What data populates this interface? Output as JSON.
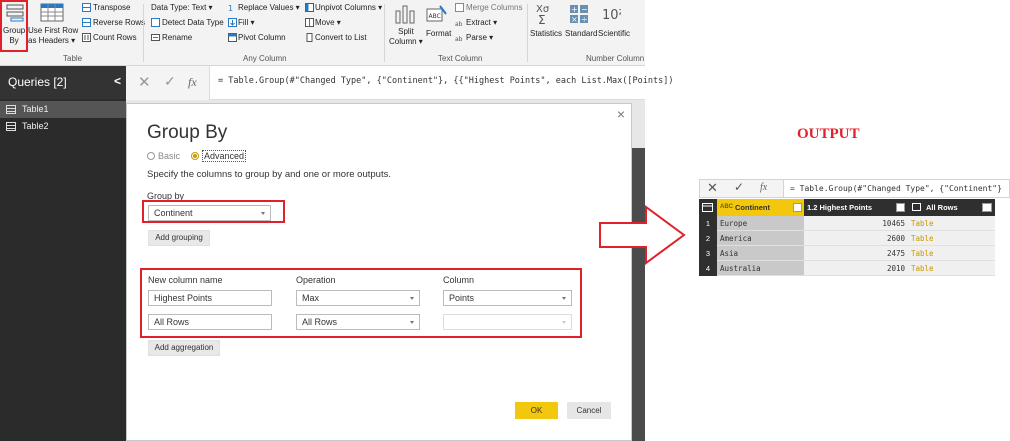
{
  "ribbon": {
    "group_by": "Group\nBy",
    "group_by_l1": "Group",
    "group_by_l2": "By",
    "use_first_row_l1": "Use First Row",
    "use_first_row_l2": "as Headers ▾",
    "transpose": "Transpose",
    "reverse_rows": "Reverse Rows",
    "count_rows": "Count Rows",
    "table_group": "Table",
    "data_type": "Data Type: Text ▾",
    "detect_data_type": "Detect Data Type",
    "rename": "Rename",
    "replace_values": "Replace Values ▾",
    "fill": "Fill ▾",
    "pivot_column": "Pivot Column",
    "unpivot_columns": "Unpivot Columns ▾",
    "move": "Move ▾",
    "convert_to_list": "Convert to List",
    "any_column_group": "Any Column",
    "split_column_l1": "Split",
    "split_column_l2": "Column ▾",
    "format": "Format",
    "merge_columns": "Merge Columns",
    "extract": "Extract ▾",
    "parse": "Parse ▾",
    "text_column_group": "Text Column",
    "statistics": "Statistics",
    "standard": "Standard",
    "scientific": "Scientific",
    "number_column_group": "Number Column",
    "abc_badge": "ABC",
    "num_badge": "10²"
  },
  "queries": {
    "header": "Queries [2]",
    "collapse": "<",
    "items": [
      {
        "label": "Table1"
      },
      {
        "label": "Table2"
      }
    ]
  },
  "formula_bar": {
    "fx": "fx",
    "text": "= Table.Group(#\"Changed Type\", {\"Continent\"}, {{\"Highest Points\", each List.Max([Points])"
  },
  "dialog": {
    "title": "Group By",
    "close": "×",
    "radio_basic": "Basic",
    "radio_advanced": "Advanced",
    "description": "Specify the columns to group by and one or more outputs.",
    "group_by_label": "Group by",
    "group_by_value": "Continent",
    "add_grouping": "Add grouping",
    "col_new_name": "New column name",
    "col_operation": "Operation",
    "col_column": "Column",
    "rows": [
      {
        "name": "Highest Points",
        "operation": "Max",
        "column": "Points"
      },
      {
        "name": "All Rows",
        "operation": "All Rows",
        "column": ""
      }
    ],
    "add_aggregation": "Add aggregation",
    "ok": "OK",
    "cancel": "Cancel"
  },
  "output": {
    "title": "OUTPUT",
    "formula": "= Table.Group(#\"Changed Type\", {\"Continent\"}",
    "fx": "fx",
    "headers": {
      "continent": "Continent",
      "highest_points": "1.2  Highest Points",
      "all_rows": "All Rows"
    },
    "rows": [
      {
        "idx": "1",
        "continent": "Europe",
        "points": "10465",
        "rows": "Table"
      },
      {
        "idx": "2",
        "continent": "America",
        "points": "2600",
        "rows": "Table"
      },
      {
        "idx": "3",
        "continent": "Asia",
        "points": "2475",
        "rows": "Table"
      },
      {
        "idx": "4",
        "continent": "Australia",
        "points": "2010",
        "rows": "Table"
      }
    ]
  },
  "colors": {
    "highlight_red": "#e0212a",
    "accent_yellow": "#f2c80f",
    "dark_pane": "#2b2b2b"
  }
}
